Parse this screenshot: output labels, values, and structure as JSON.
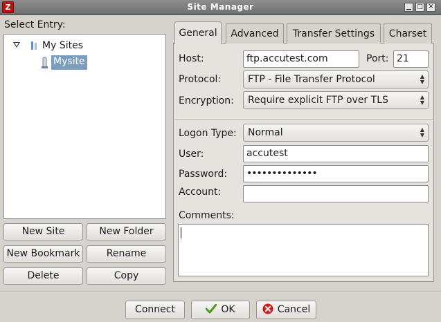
{
  "window": {
    "title": "Site Manager",
    "app_icon": "filezilla-icon",
    "controls": [
      "minimize-icon",
      "maximize-icon",
      "close-icon"
    ]
  },
  "tree": {
    "label": "Select Entry:",
    "root_label": "My Sites",
    "root_icon": "folder-icon",
    "items": [
      {
        "label": "Mysite",
        "icon": "site-icon",
        "selected": true
      }
    ]
  },
  "left_buttons": {
    "new_site": "New Site",
    "new_folder": "New Folder",
    "new_bookmark": "New Bookmark",
    "rename": "Rename",
    "delete": "Delete",
    "copy": "Copy"
  },
  "tabs": [
    {
      "label": "General",
      "active": true
    },
    {
      "label": "Advanced",
      "active": false
    },
    {
      "label": "Transfer Settings",
      "active": false
    },
    {
      "label": "Charset",
      "active": false
    }
  ],
  "general": {
    "host_label": "Host:",
    "host_value": "ftp.accutest.com",
    "port_label": "Port:",
    "port_value": "21",
    "protocol_label": "Protocol:",
    "protocol_value": "FTP - File Transfer Protocol",
    "encryption_label": "Encryption:",
    "encryption_value": "Require explicit FTP over TLS",
    "logon_type_label": "Logon Type:",
    "logon_type_value": "Normal",
    "user_label": "User:",
    "user_value": "accutest",
    "password_label": "Password:",
    "password_value": "••••••••••••••",
    "account_label": "Account:",
    "account_value": "",
    "comments_label": "Comments:",
    "comments_value": ""
  },
  "footer": {
    "connect": "Connect",
    "ok": "OK",
    "cancel": "Cancel",
    "ok_icon": "checkmark-icon",
    "cancel_icon": "cancel-icon"
  },
  "colors": {
    "selection": "#7b9ebf",
    "titlebar": "#7e7e7e",
    "ok_check": "#4a9a1e",
    "cancel_red": "#cc2222"
  }
}
